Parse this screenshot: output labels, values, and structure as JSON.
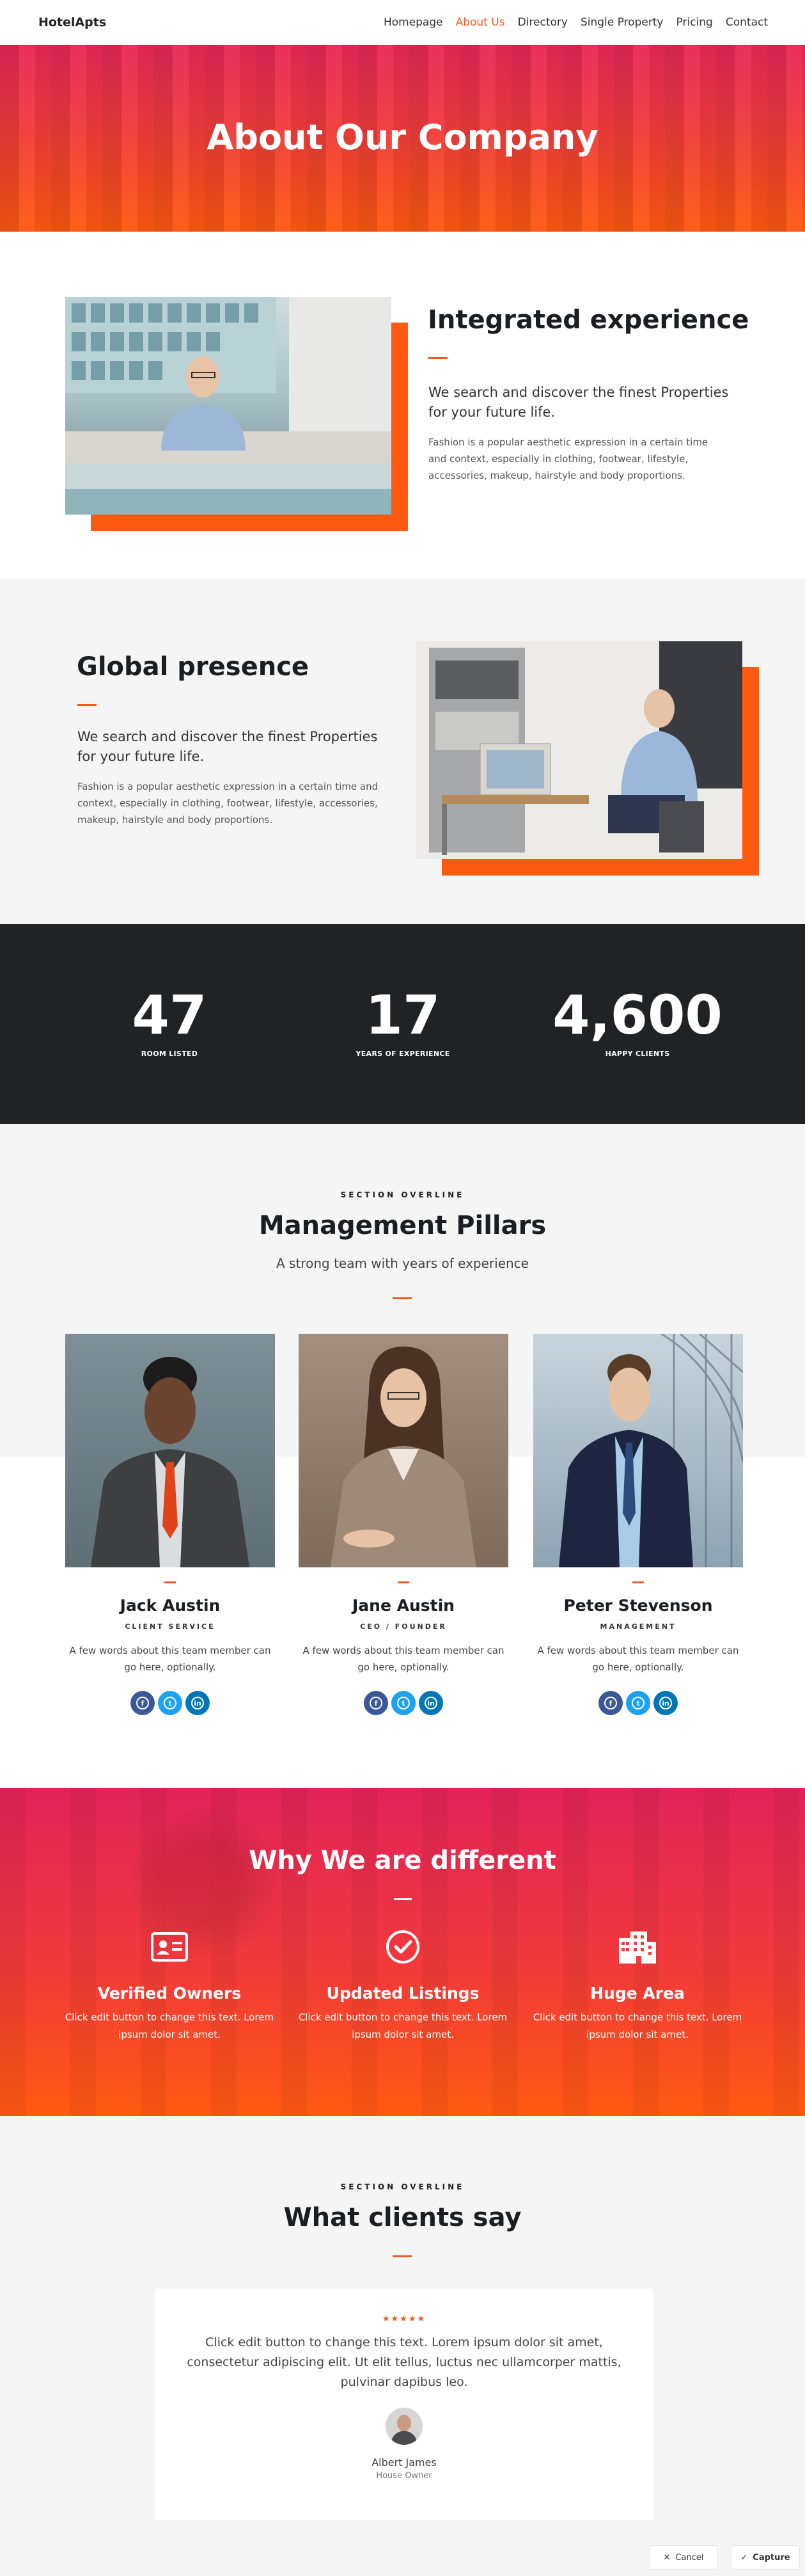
{
  "nav": {
    "logo": "HotelApts",
    "items": [
      {
        "label": "Homepage",
        "active": false
      },
      {
        "label": "About Us",
        "active": true
      },
      {
        "label": "Directory",
        "active": false
      },
      {
        "label": "Single Property",
        "active": false
      },
      {
        "label": "Pricing",
        "active": false
      },
      {
        "label": "Contact",
        "active": false
      }
    ]
  },
  "hero": {
    "title": "About Our Company"
  },
  "feature1": {
    "title": "Integrated experience",
    "lead": "We search and discover the finest Properties for your future life.",
    "body": "Fashion is a popular aesthetic expression in a certain time and context, especially in clothing, footwear, lifestyle, accessories, makeup, hairstyle and body proportions."
  },
  "feature2": {
    "title": "Global presence",
    "lead": "We search and discover the finest Properties for your future life.",
    "body": "Fashion is a popular aesthetic expression in a certain time and context, especially in clothing, footwear, lifestyle, accessories, makeup, hairstyle and body proportions."
  },
  "stats": [
    {
      "value": "47",
      "label": "ROOM LISTED"
    },
    {
      "value": "17",
      "label": "YEARS OF EXPERIENCE"
    },
    {
      "value": "4,600",
      "label": "HAPPY CLIENTS"
    }
  ],
  "team": {
    "overline": "SECTION OVERLINE",
    "title": "Management Pillars",
    "subtitle": "A strong team with years of experience",
    "members": [
      {
        "name": "Jack Austin",
        "role": "CLIENT SERVICE",
        "desc": "A few words about this team member can go here, optionally."
      },
      {
        "name": "Jane Austin",
        "role": "CEO / FOUNDER",
        "desc": "A few words about this team member can go here, optionally."
      },
      {
        "name": "Peter Stevenson",
        "role": "MANAGEMENT",
        "desc": "A few words about this team member can go here, optionally."
      }
    ]
  },
  "why": {
    "title": "Why We are different",
    "items": [
      {
        "title": "Verified Owners",
        "text": "Click edit button to change this text. Lorem ipsum dolor sit amet.",
        "icon": "id-card-icon"
      },
      {
        "title": "Updated Listings",
        "text": "Click edit button to change this text. Lorem ipsum dolor sit amet.",
        "icon": "check-circle-icon"
      },
      {
        "title": "Huge Area",
        "text": "Click edit button to change this text. Lorem ipsum dolor sit amet.",
        "icon": "building-icon"
      }
    ]
  },
  "testimonials": {
    "overline": "SECTION OVERLINE",
    "title": "What clients say",
    "stars": "★★★★★",
    "quote": "Click edit button to change this text. Lorem ipsum dolor sit amet, consectetur adipiscing elit. Ut elit tellus, luctus nec ullamcorper mattis, pulvinar dapibus leo.",
    "name": "Albert James",
    "role": "House Owner"
  },
  "capture_bar": {
    "cancel": "Cancel",
    "capture": "Capture"
  },
  "colors": {
    "accent": "#f15a22",
    "dark": "#212226",
    "hero_top": "#e8285a",
    "hero_bottom": "#ff5a10"
  }
}
